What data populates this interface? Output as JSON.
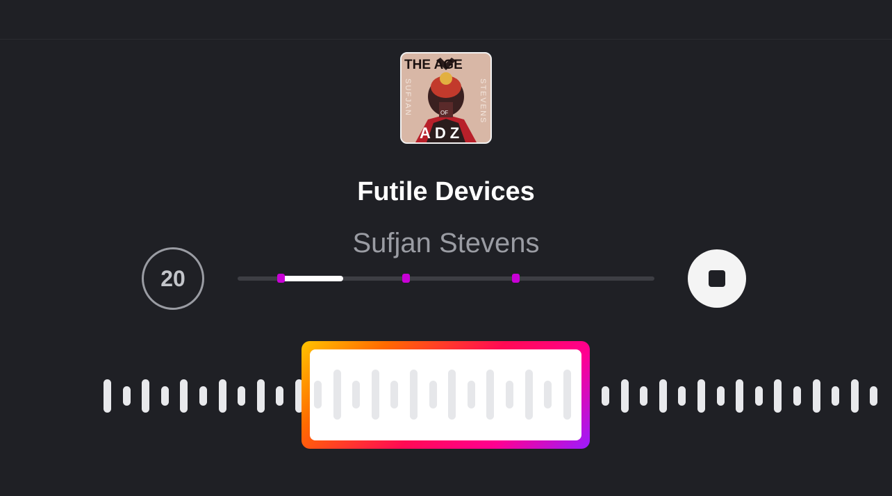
{
  "album": {
    "title_top": "THE AGE",
    "title_of": "OF",
    "title_bottom": "ADZ",
    "artist_left": "SUFJAN",
    "artist_right": "STEVENS"
  },
  "track": {
    "title": "Futile Devices",
    "artist": "Sufjan Stevens"
  },
  "controls": {
    "skip_label": "20",
    "stop_icon": "stop-icon",
    "skip_icon": "skip-20-icon"
  },
  "colors": {
    "background": "#1f2025",
    "marker": "#c800d6",
    "accent_gradient": [
      "#ffc400",
      "#ff0a54",
      "#9a1cff"
    ]
  },
  "progress": {
    "played_fraction": 0.15
  }
}
